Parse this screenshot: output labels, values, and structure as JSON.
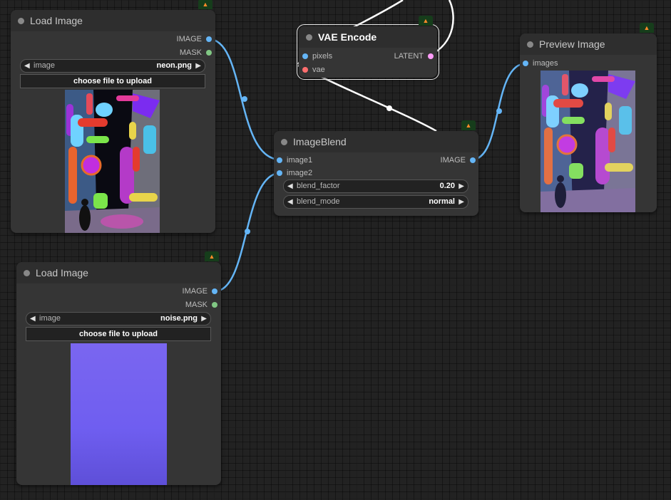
{
  "nodes": {
    "load_image_1": {
      "title": "Load Image",
      "outputs": [
        "IMAGE",
        "MASK"
      ],
      "widget_label": "image",
      "widget_value": "neon.png",
      "upload_label": "choose file to upload"
    },
    "load_image_2": {
      "title": "Load Image",
      "outputs": [
        "IMAGE",
        "MASK"
      ],
      "widget_label": "image",
      "widget_value": "noise.png",
      "upload_label": "choose file to upload"
    },
    "vae_encode": {
      "title": "VAE Encode",
      "inputs": [
        "pixels",
        "vae"
      ],
      "outputs": [
        "LATENT"
      ]
    },
    "image_blend": {
      "title": "ImageBlend",
      "inputs": [
        "image1",
        "image2"
      ],
      "outputs": [
        "IMAGE"
      ],
      "blend_factor_label": "blend_factor",
      "blend_factor_value": "0.20",
      "blend_mode_label": "blend_mode",
      "blend_mode_value": "normal"
    },
    "preview_image": {
      "title": "Preview Image",
      "inputs": [
        "images"
      ]
    }
  },
  "colors": {
    "image_link": "#64b5f6",
    "mask_pin": "#81c784",
    "latent_pin": "#ff9cf9",
    "vae_pin": "#ff6e6e",
    "selected_link": "#ffffff",
    "badge_bg": "#163d1b"
  },
  "icons": {
    "badge": "fox-icon",
    "arrow_left": "triangle-left-icon",
    "arrow_right": "triangle-right-icon"
  }
}
